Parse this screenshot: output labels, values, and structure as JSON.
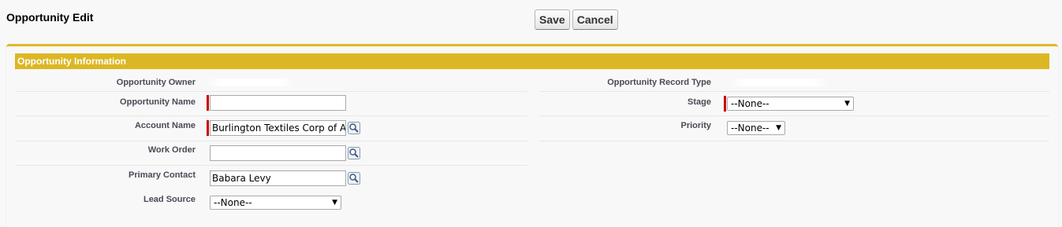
{
  "page": {
    "title": "Opportunity Edit"
  },
  "toolbar": {
    "save_label": "Save",
    "cancel_label": "Cancel"
  },
  "section": {
    "title": "Opportunity Information"
  },
  "fields": {
    "owner_label": "Opportunity Owner",
    "record_type_label": "Opportunity Record Type",
    "name_label": "Opportunity Name",
    "name_value": "",
    "stage_label": "Stage",
    "stage_value": "--None--",
    "account_label": "Account Name",
    "account_value": "Burlington Textiles Corp of A",
    "priority_label": "Priority",
    "priority_value": "--None--",
    "work_order_label": "Work Order",
    "work_order_value": "",
    "contact_label": "Primary Contact",
    "contact_value": "Babara Levy",
    "lead_source_label": "Lead Source",
    "lead_source_value": "--None--"
  },
  "icons": {
    "lookup": "lookup-magnifier-icon",
    "dropdown": "chevron-down-icon"
  },
  "colors": {
    "section_header": "#dcb724",
    "required": "#cc0000",
    "card_border": "#e0b826"
  }
}
